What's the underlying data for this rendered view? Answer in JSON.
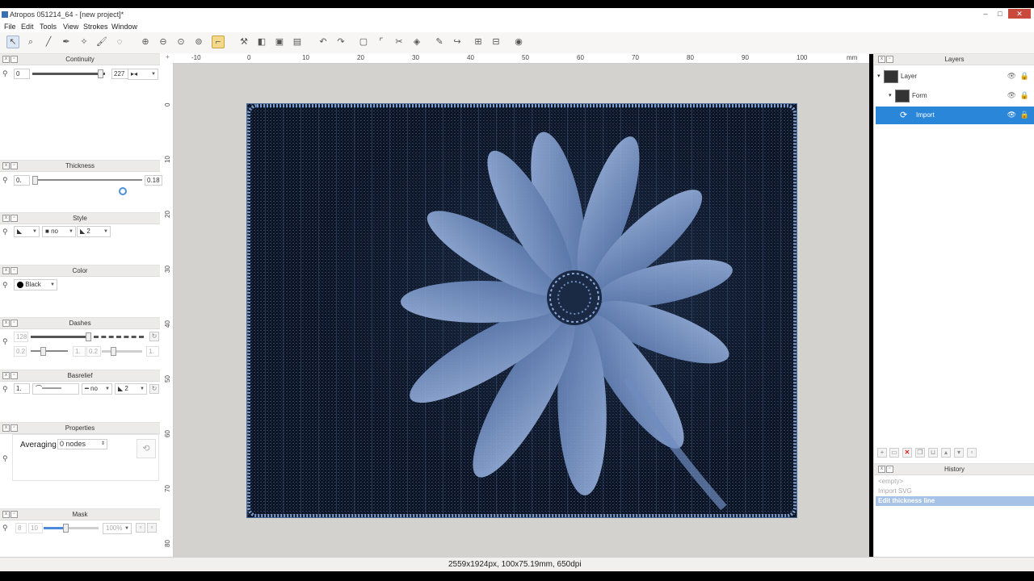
{
  "window": {
    "title": "Atropos 051214_64 - [new project]*",
    "min": "–",
    "max": "□",
    "close": "✕"
  },
  "menu": [
    "File",
    "Edit",
    "Tools",
    "View",
    "Strokes",
    "Window"
  ],
  "toolbar": {
    "icons": [
      "pointer-icon",
      "magnifier-icon",
      "line-icon",
      "pen-icon",
      "wand-icon",
      "brush-icon",
      "lasso-icon",
      "zoom-in-icon",
      "zoom-out-icon",
      "zoom-fit-icon",
      "zoom-actual-icon",
      "bracket-tool-icon",
      "stamp-icon",
      "bucket-icon",
      "save-icon",
      "save-as-icon",
      "undo-icon",
      "redo-icon",
      "doc-icon",
      "corner-icon",
      "scissors-icon",
      "eraser-icon",
      "pencil-edit-icon",
      "arrow-icon",
      "grid-a-icon",
      "grid-b-icon",
      "globe-icon"
    ]
  },
  "left": {
    "continuity": {
      "title": "Continuity",
      "min_value": "0",
      "max_value": "227"
    },
    "thickness": {
      "title": "Thickness",
      "min_value": "0.",
      "max_value": "0.18"
    },
    "style": {
      "title": "Style",
      "cap_value": "no",
      "join_value": "2"
    },
    "color": {
      "title": "Color",
      "value": "Black"
    },
    "dashes": {
      "title": "Dashes",
      "count": "128",
      "v1": "0.2",
      "v2": "1.",
      "v3": "0.2",
      "v4": "1."
    },
    "baserelief": {
      "title": "Basrelief",
      "v1": "1.",
      "v2": "no",
      "v3": "2"
    },
    "properties": {
      "title": "Properties",
      "averaging_label": "Averaging",
      "averaging_value": "0 nodes"
    },
    "mask": {
      "title": "Mask",
      "v1": "8",
      "v2": "10",
      "percent": "100%"
    }
  },
  "ruler": {
    "top": [
      "-10",
      "0",
      "10",
      "20",
      "30",
      "40",
      "50",
      "60",
      "70",
      "80",
      "90",
      "100",
      "mm"
    ],
    "left": [
      "0",
      "10",
      "20",
      "30",
      "40",
      "50",
      "60",
      "70",
      "80"
    ]
  },
  "layers": {
    "title": "Layers",
    "items": [
      {
        "label": "Layer",
        "selected": false
      },
      {
        "label": "Form",
        "selected": false
      },
      {
        "label": "Import",
        "selected": true
      }
    ]
  },
  "history": {
    "title": "History",
    "items": [
      {
        "label": "<empty>",
        "selected": false
      },
      {
        "label": "Import SVG",
        "selected": false
      },
      {
        "label": "Edit thickness line",
        "selected": true
      }
    ]
  },
  "status": {
    "text": "2559x1924px, 100x75.19mm, 650dpi"
  }
}
